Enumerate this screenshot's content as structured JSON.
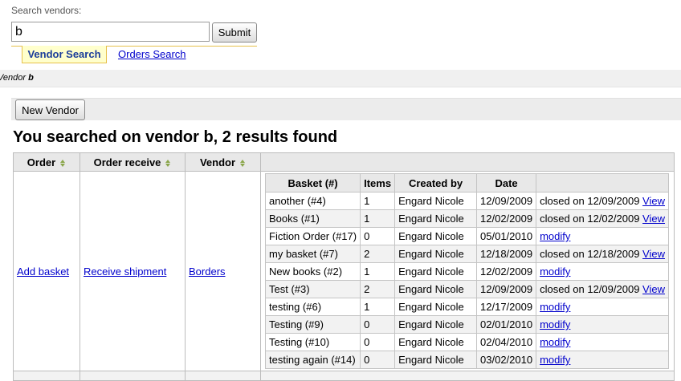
{
  "search": {
    "label": "Search vendors:",
    "value": "b",
    "submit_label": "Submit"
  },
  "tabs": {
    "vendor_search": "Vendor Search",
    "orders_search": "Orders Search"
  },
  "breadcrumb": {
    "prefix": "Vendor",
    "term": "b"
  },
  "toolbar": {
    "new_vendor_label": "New Vendor"
  },
  "results": {
    "heading": "You searched on vendor b, 2 results found",
    "columns": {
      "order": "Order",
      "order_receive": "Order receive",
      "vendor": "Vendor"
    },
    "row": {
      "add_basket": "Add basket",
      "receive_shipment": "Receive shipment",
      "vendor_name": "Borders"
    }
  },
  "baskets": {
    "columns": [
      "Basket (#)",
      "Items",
      "Created by",
      "Date",
      ""
    ],
    "rows": [
      {
        "basket": "another (#4)",
        "items": "1",
        "created_by": "Engard Nicole",
        "date": "12/09/2009",
        "status": "closed on 12/09/2009",
        "action": "View"
      },
      {
        "basket": "Books (#1)",
        "items": "1",
        "created_by": "Engard Nicole",
        "date": "12/02/2009",
        "status": "closed on 12/02/2009",
        "action": "View"
      },
      {
        "basket": "Fiction Order (#17)",
        "items": "0",
        "created_by": "Engard Nicole",
        "date": "05/01/2010",
        "status": "",
        "action": "modify"
      },
      {
        "basket": "my basket (#7)",
        "items": "2",
        "created_by": "Engard Nicole",
        "date": "12/18/2009",
        "status": "closed on 12/18/2009",
        "action": "View"
      },
      {
        "basket": "New books (#2)",
        "items": "1",
        "created_by": "Engard Nicole",
        "date": "12/02/2009",
        "status": "",
        "action": "modify"
      },
      {
        "basket": "Test (#3)",
        "items": "2",
        "created_by": "Engard Nicole",
        "date": "12/09/2009",
        "status": "closed on 12/09/2009",
        "action": "View"
      },
      {
        "basket": "testing (#6)",
        "items": "1",
        "created_by": "Engard Nicole",
        "date": "12/17/2009",
        "status": "",
        "action": "modify"
      },
      {
        "basket": "Testing (#9)",
        "items": "0",
        "created_by": "Engard Nicole",
        "date": "02/01/2010",
        "status": "",
        "action": "modify"
      },
      {
        "basket": "Testing (#10)",
        "items": "0",
        "created_by": "Engard Nicole",
        "date": "02/04/2010",
        "status": "",
        "action": "modify"
      },
      {
        "basket": "testing again (#14)",
        "items": "0",
        "created_by": "Engard Nicole",
        "date": "03/02/2010",
        "status": "",
        "action": "modify"
      }
    ]
  }
}
